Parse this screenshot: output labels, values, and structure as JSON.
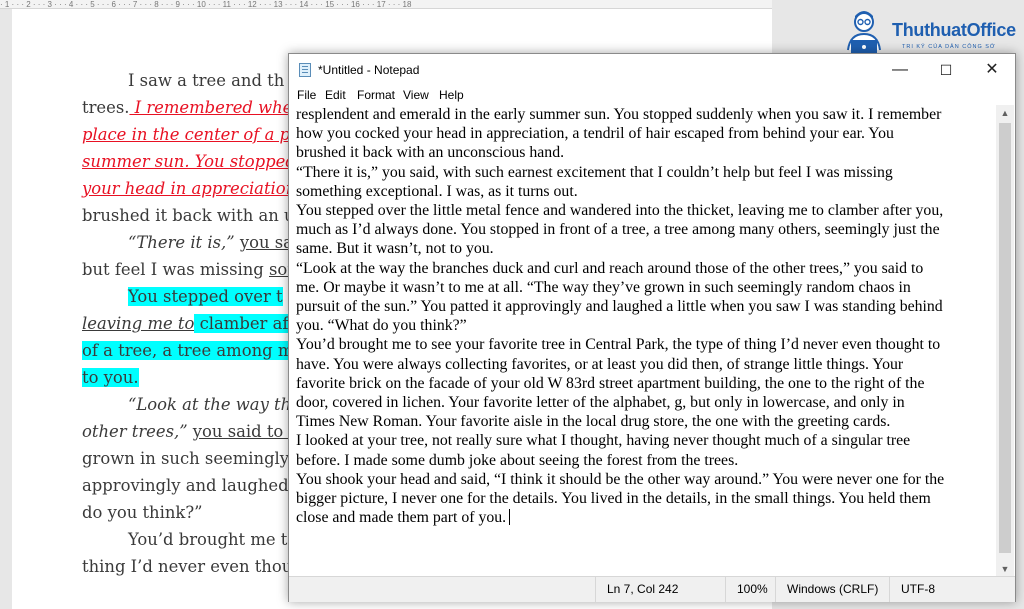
{
  "word": {
    "ruler": "· 1 · · · 2 · · · 3 · · · 4 · · · 5 · · · 6 · · · 7 · · · 8 · · · 9 · · · 10 · · · 11 · · · 12 · · · 13 · · · 14 · · · 15 · · · 16 · · · 17 · · · 18",
    "lines": {
      "l1": "I saw a tree and th",
      "l2a": "trees.",
      "l2b": " I remembered when",
      "l3": "place in the center of a pl",
      "l4": "summer sun. You stopped",
      "l5": "your head in appreciation",
      "l6": "brushed it back with an u",
      "l7a": "“There it is,” ",
      "l7b": "you sai",
      "l8a": "but feel I was missing ",
      "l8b": "som",
      "l9": "You stepped over t",
      "l10a": "leaving me to",
      "l10b": " clamber afte",
      "l11": "of a tree, a tree among ma",
      "l12": "to you.",
      "l13": "“Look at the way the",
      "l14a": "other trees,” ",
      "l14b": "you said to n",
      "l15": "grown in such seemingly",
      "l16": "approvingly and laughed a",
      "l17": "do you think?”",
      "l18": "You’d brought me t",
      "l19": "thing I’d never even thoug"
    }
  },
  "logo": {
    "name": "ThuthuatOffice",
    "tagline": "TRI KỶ CỦA DÂN CÔNG SỞ"
  },
  "notepad": {
    "title": "*Untitled - Notepad",
    "controls": {
      "minimize": "—",
      "maximize": "☐",
      "close": "✕"
    },
    "menu": [
      "File",
      "Edit",
      "Format",
      "View",
      "Help"
    ],
    "lines": [
      "resplendent and emerald in the early summer sun. You stopped suddenly when you saw it. I remember",
      "how you cocked your head in appreciation, a tendril of hair escaped from behind your ear. You",
      "brushed it back with an unconscious hand.",
      "“There it is,” you said, with such earnest excitement that I couldn’t help but feel I was missing",
      "something exceptional. I was, as it turns out.",
      "You stepped over the little metal fence and wandered into the thicket, leaving me to clamber after you,",
      "much as I’d always done. You stopped in front of a tree, a tree among many others, seemingly just the",
      "same. But it wasn’t, not to you.",
      "“Look at the way the branches duck and curl and reach around those of the other trees,” you said to",
      "me. Or maybe it wasn’t to me at all. “The way they’ve grown in such seemingly random chaos in",
      "pursuit of the sun.” You patted it approvingly and laughed a little when you saw I was standing behind",
      "you. “What do you think?”",
      "You’d brought me to see your favorite tree in Central Park, the type of thing I’d never even thought to",
      "have. You were always collecting favorites, or at least you did then, of strange little things. Your",
      "favorite brick on the facade of your old W 83rd street apartment building, the one to the right of the",
      "door, covered in lichen. Your favorite letter of the alphabet, g, but only in lowercase, and only in",
      "Times New Roman. Your favorite aisle in the local drug store, the one with the greeting cards.",
      "I looked at your tree, not really sure what I thought, having never thought much of a singular tree",
      "before. I made some dumb joke about seeing the forest from the trees.",
      "You shook your head and said, “I think it should be the other way around.” You were never one for the",
      "bigger picture, I never one for the details. You lived in the details, in the small things. You held them",
      "close and made them part of you."
    ],
    "status": {
      "position": "Ln 7, Col 242",
      "zoom": "100%",
      "line_ending": "Windows (CRLF)",
      "encoding": "UTF-8"
    }
  }
}
